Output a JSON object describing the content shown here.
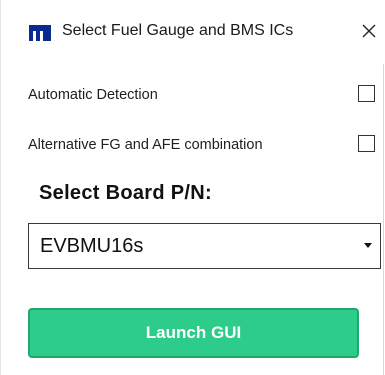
{
  "window": {
    "title": "Select Fuel Gauge and BMS ICs",
    "app_icon": "maxim-logo-icon",
    "close_icon": "close-icon"
  },
  "options": [
    {
      "label": "Automatic Detection",
      "checked": false
    },
    {
      "label": "Alternative FG and AFE combination",
      "checked": false
    }
  ],
  "board": {
    "heading": "Select Board P/N:",
    "selected_value": "EVBMU16s"
  },
  "launch": {
    "label": "Launch GUI"
  },
  "colors": {
    "brand": "#0a2a8f",
    "launch_button": "#2ecc8a",
    "launch_border": "#22a86c"
  }
}
